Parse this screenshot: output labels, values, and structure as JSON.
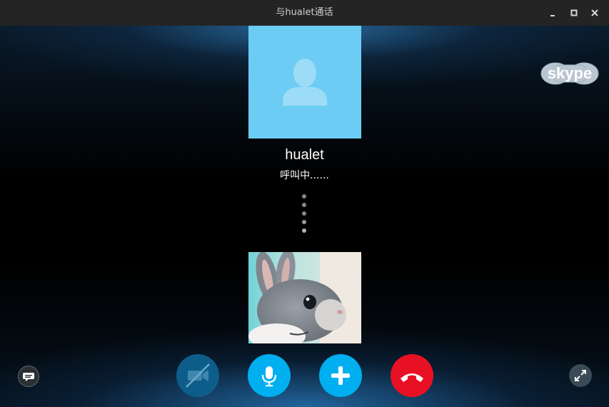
{
  "window": {
    "title": "与hualet通话",
    "controls": {
      "minimize_icon": "minimize-icon",
      "maximize_icon": "maximize-icon",
      "close_icon": "close-icon"
    }
  },
  "brand": {
    "logo_text": "skype"
  },
  "caller": {
    "name": "hualet",
    "status": "呼叫中......",
    "avatar_icon": "default-avatar-icon"
  },
  "connecting_indicator": {
    "dots": 5
  },
  "self_view": {
    "content": "rabbit photo"
  },
  "call_controls": [
    {
      "name": "video-toggle-button",
      "icon": "video-off-icon",
      "color": "#0d5d8a"
    },
    {
      "name": "microphone-button",
      "icon": "microphone-icon",
      "color": "#00aff0"
    },
    {
      "name": "add-participant-button",
      "icon": "plus-icon",
      "color": "#00aff0"
    },
    {
      "name": "end-call-button",
      "icon": "hang-up-icon",
      "color": "#e81123"
    }
  ],
  "side_controls": {
    "chat_icon": "chat-bubble-icon",
    "fullscreen_icon": "fullscreen-expand-icon"
  },
  "colors": {
    "titlebar": "#242424",
    "avatar_bg": "#6cccf4",
    "accent_blue": "#00aff0",
    "end_call_red": "#e81123"
  }
}
